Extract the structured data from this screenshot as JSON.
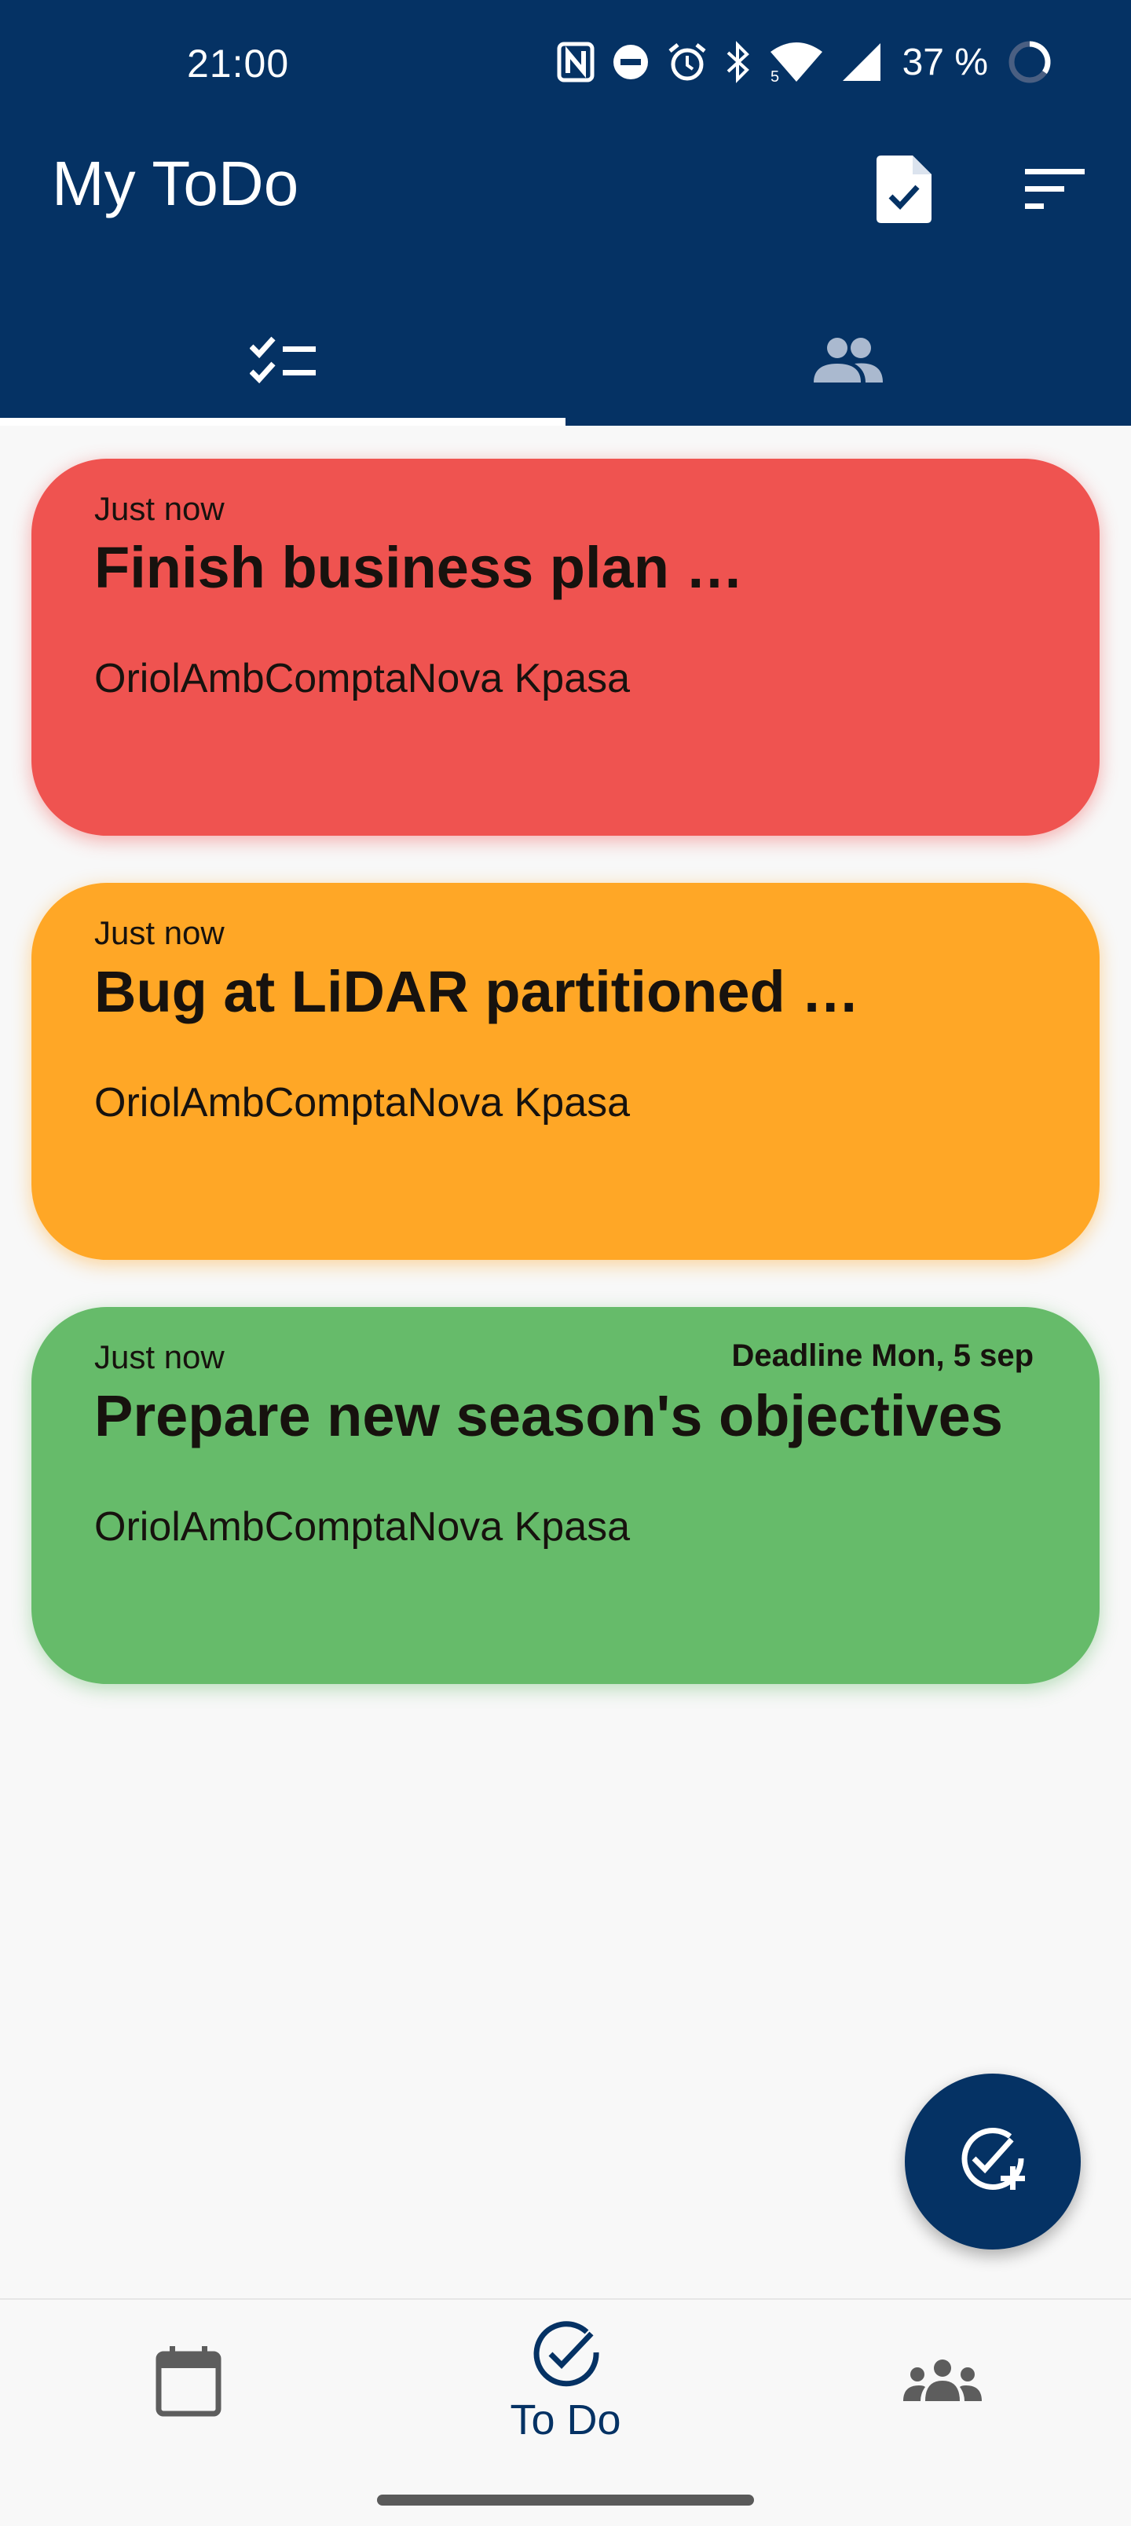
{
  "status_bar": {
    "time": "21:00",
    "battery_text": "37 %",
    "icons": [
      "nfc-icon",
      "dnd-icon",
      "alarm-icon",
      "bluetooth-icon",
      "wifi-icon",
      "signal-icon",
      "battery-icon"
    ]
  },
  "app_bar": {
    "title": "My ToDo",
    "actions": [
      "task-document-icon",
      "sort-icon"
    ]
  },
  "tabs": [
    {
      "icon": "checklist-icon",
      "selected": true
    },
    {
      "icon": "group-icon",
      "selected": false
    }
  ],
  "tasks": [
    {
      "time": "Just now",
      "title": "Finish business plan …",
      "user": "OriolAmbComptaNova Kpasa",
      "deadline": "",
      "color": "#ef5350"
    },
    {
      "time": "Just now",
      "title": "Bug at LiDAR partitioned …",
      "user": "OriolAmbComptaNova Kpasa",
      "deadline": "",
      "color": "#ffa726"
    },
    {
      "time": "Just now",
      "title": "Prepare new season's objectives",
      "user": "OriolAmbComptaNova Kpasa",
      "deadline": "Deadline Mon, 5 sep",
      "color": "#66bb6a"
    }
  ],
  "fab": {
    "icon": "add-task-icon"
  },
  "bottom_nav": {
    "items": [
      {
        "icon": "calendar-icon",
        "label": ""
      },
      {
        "icon": "check-circle-icon",
        "label": "To Do"
      },
      {
        "icon": "groups-icon",
        "label": ""
      }
    ],
    "selected": 1
  },
  "colors": {
    "primary": "#053264",
    "background": "#f8f8f8",
    "card_text": "#17120e"
  }
}
